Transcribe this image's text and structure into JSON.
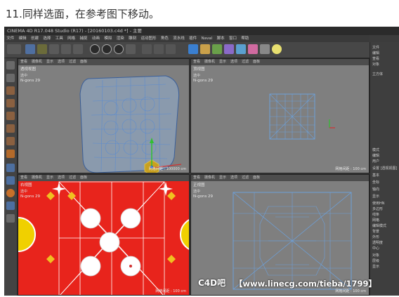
{
  "caption": "11.同样选面，在参考图下移动。",
  "app": {
    "title": "CINEMA 4D R17.048 Studio (R17) - [20160103.c4d *] - 主要",
    "menu": [
      "文件",
      "编辑",
      "创建",
      "选择",
      "工具",
      "网格",
      "捕捉",
      "动画",
      "模拟",
      "渲染",
      "雕刻",
      "运动图形",
      "角色",
      "流水线",
      "插件",
      "Naval",
      "脚本",
      "窗口",
      "帮助"
    ],
    "colors": {
      "viewport_bg": "#7f7f7f",
      "mesh": "#6ea0d8",
      "red_ref": "#e8241c",
      "ui_dark": "#3c3c3c"
    }
  },
  "viewports": {
    "menu": [
      "查看",
      "摄像机",
      "显示",
      "选项",
      "过滤",
      "面板"
    ],
    "perspective": {
      "name": "透视视图",
      "stat_label": "选中",
      "ngons": "N-gons   29",
      "grid": "网格间距 : 100000 cm"
    },
    "top": {
      "name": "顶视图",
      "stat_label": "选中",
      "ngons": "N-gons   29",
      "grid": "网格间距 : 100 cm"
    },
    "right": {
      "name": "右视图",
      "stat_label": "选中",
      "ngons": "N-gons   29",
      "grid": "网格间距 : 100 cm"
    },
    "front": {
      "name": "正视图",
      "stat_label": "选中",
      "ngons": "N-gons   29",
      "grid": "网格间距 : 100 cm"
    }
  },
  "right_panel": {
    "items": [
      "文件",
      "编辑",
      "查看",
      "对象",
      "立方体",
      "模式",
      "编辑",
      "用户",
      "设置 [透视视图]",
      "基本",
      "坐标",
      "轴向",
      "显示",
      "使用HN",
      "多边形",
      "线条",
      "网格",
      "编辑模式",
      "背景",
      "外形",
      "透明度",
      "中心",
      "对象",
      "层级",
      "显示"
    ]
  },
  "watermark": {
    "logo": "C4D吧",
    "text": "【www.linecg.com/tieba/1799】"
  }
}
